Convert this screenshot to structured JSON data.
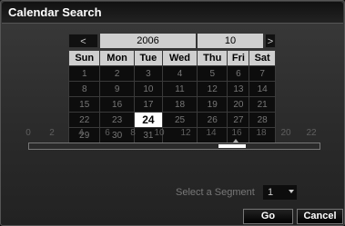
{
  "window": {
    "title": "Calendar Search"
  },
  "header": {
    "prev_icon": "<",
    "year": "2006",
    "month": "10",
    "next_icon": ">"
  },
  "calendar": {
    "weekdays": [
      "Sun",
      "Mon",
      "Tue",
      "Wed",
      "Thu",
      "Fri",
      "Sat"
    ],
    "weeks": [
      [
        "1",
        "2",
        "3",
        "4",
        "5",
        "6",
        "7"
      ],
      [
        "8",
        "9",
        "10",
        "11",
        "12",
        "13",
        "14"
      ],
      [
        "15",
        "16",
        "17",
        "18",
        "19",
        "20",
        "21"
      ],
      [
        "22",
        "23",
        "24",
        "25",
        "26",
        "27",
        "28"
      ],
      [
        "29",
        "30",
        "31",
        "",
        "",
        "",
        ""
      ]
    ],
    "selected_day": "24"
  },
  "timeline": {
    "ticks": [
      "0",
      "2",
      "4",
      "6",
      "8",
      "10",
      "12",
      "14",
      "16",
      "18",
      "20",
      "22"
    ],
    "segment_start_hour": 14.8,
    "segment_end_hour": 16.8
  },
  "segment": {
    "label": "Select a Segment",
    "value": "1"
  },
  "buttons": {
    "go": "Go",
    "cancel": "Cancel"
  },
  "colors": {
    "selected_bg": "#ffffff",
    "header_bg": "#cfcfcf",
    "cell_bg": "#0d0d0d"
  }
}
